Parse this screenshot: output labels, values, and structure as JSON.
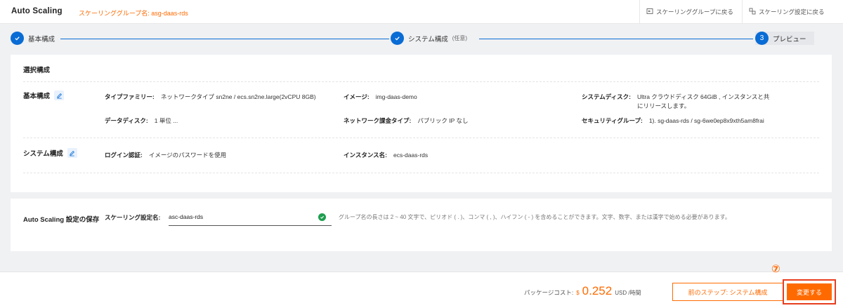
{
  "header": {
    "title": "Auto Scaling",
    "group_name": "スケーリンググループ名: asg-daas-rds",
    "back_to_group": "スケーリンググループに戻る",
    "back_to_config": "スケーリング設定に戻る"
  },
  "steps": [
    {
      "label": "基本構成",
      "status": "done"
    },
    {
      "label": "システム構成",
      "note": "(任意)",
      "status": "done"
    },
    {
      "label": "プレビュー",
      "number": "3",
      "status": "current"
    }
  ],
  "selected": {
    "title": "選択構成",
    "basic": {
      "label": "基本構成",
      "type_family_key": "タイプファミリー:",
      "type_family_val": "ネットワークタイプ sn2ne / ecs.sn2ne.large(2vCPU 8GB)",
      "image_key": "イメージ:",
      "image_val": "img-daas-demo",
      "system_disk_key": "システムディスク:",
      "system_disk_val": "Ultra クラウドディスク 64GiB , インスタンスと共にリリースします。",
      "data_disk_key": "データディスク:",
      "data_disk_val": "1 単位 ...",
      "billing_key": "ネットワーク課金タイプ:",
      "billing_val": "パブリック IP なし",
      "security_key": "セキュリティグループ:",
      "security_val": "1). sg-daas-rds / sg-6we0ep8x9xth5am8frai"
    },
    "system": {
      "label": "システム構成",
      "login_key": "ログイン認証:",
      "login_val": "イメージのパスワードを使用",
      "instance_key": "インスタンス名:",
      "instance_val": "ecs-daas-rds"
    }
  },
  "save": {
    "label": "Auto Scaling 設定の保存",
    "field_label": "スケーリング設定名:",
    "field_value": "asc-daas-rds",
    "hint": "グループ名の長さは 2 ~ 40 文字で、ピリオド ( . )、コンマ ( , )、ハイフン ( - ) を含めることができます。文字、数字、または漢字で始める必要があります。"
  },
  "footer": {
    "cost_label": "パッケージコスト:",
    "currency": "$",
    "amount": "0.252",
    "unit": "USD /時間",
    "prev_button": "前のステップ:  システム構成",
    "next_button": "変更する",
    "marker": "⑦"
  },
  "colors": {
    "accent": "#ff6a00",
    "primary": "#0a6cd5",
    "highlight": "#e83d1f"
  }
}
